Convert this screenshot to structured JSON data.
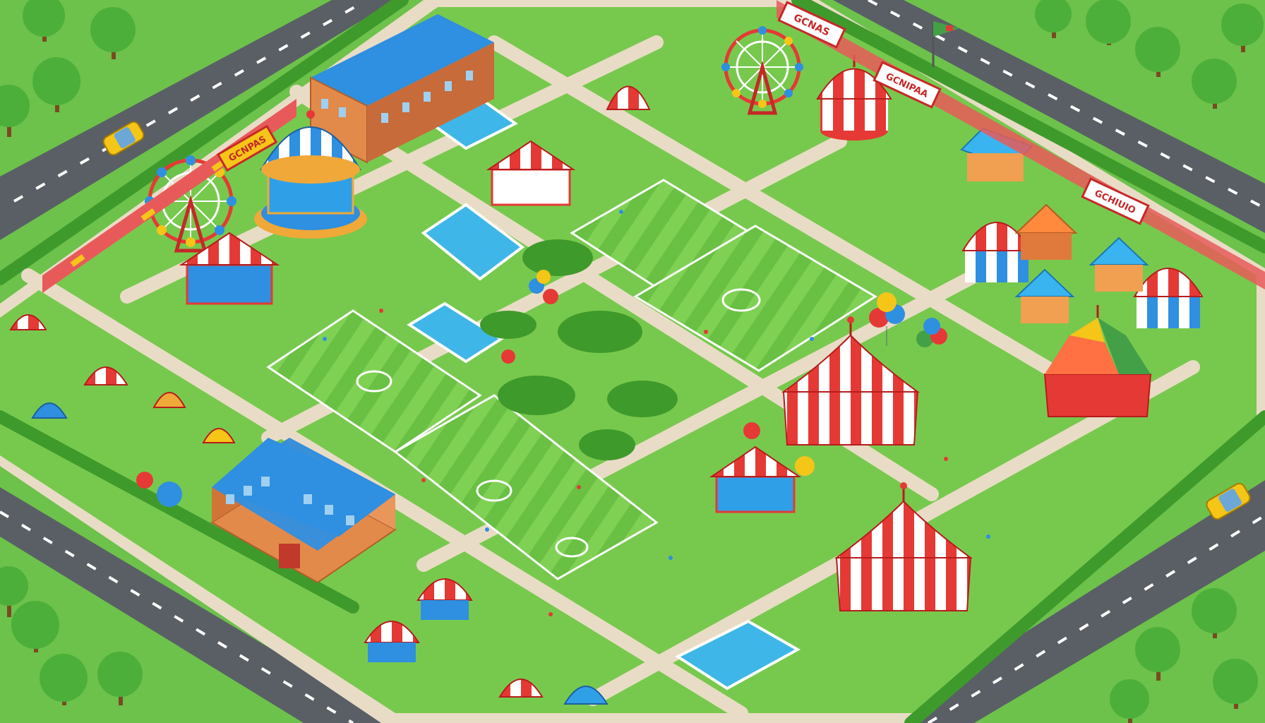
{
  "scene": {
    "palette": {
      "grass": "#6cc24a",
      "grass_light": "#8fd65a",
      "road": "#5a5f66",
      "road_line": "#ffffff",
      "path": "#e9dcc6",
      "hedge": "#3f9a2c",
      "tree": "#4caf3a",
      "tent_red": "#e53935",
      "tent_white": "#ffffff",
      "tent_blue": "#2f8fe0",
      "building_wall": "#e28a4a",
      "building_roof": "#2f8fe0",
      "pitch": "#73c94b",
      "pool": "#3fb6e8",
      "car_yellow": "#f5c518"
    },
    "signs": [
      {
        "label": "GCNAS"
      },
      {
        "label": "GCNIPAA"
      },
      {
        "label": "GCHIUIO"
      },
      {
        "label": "GCNPAS"
      }
    ],
    "icons": [
      "ferris-wheel-icon",
      "carousel-icon",
      "circus-tent-icon",
      "school-building-icon",
      "soccer-pitch-icon",
      "swimming-pool-icon",
      "balloon-icon",
      "car-icon",
      "tree-icon",
      "flag-icon"
    ]
  }
}
